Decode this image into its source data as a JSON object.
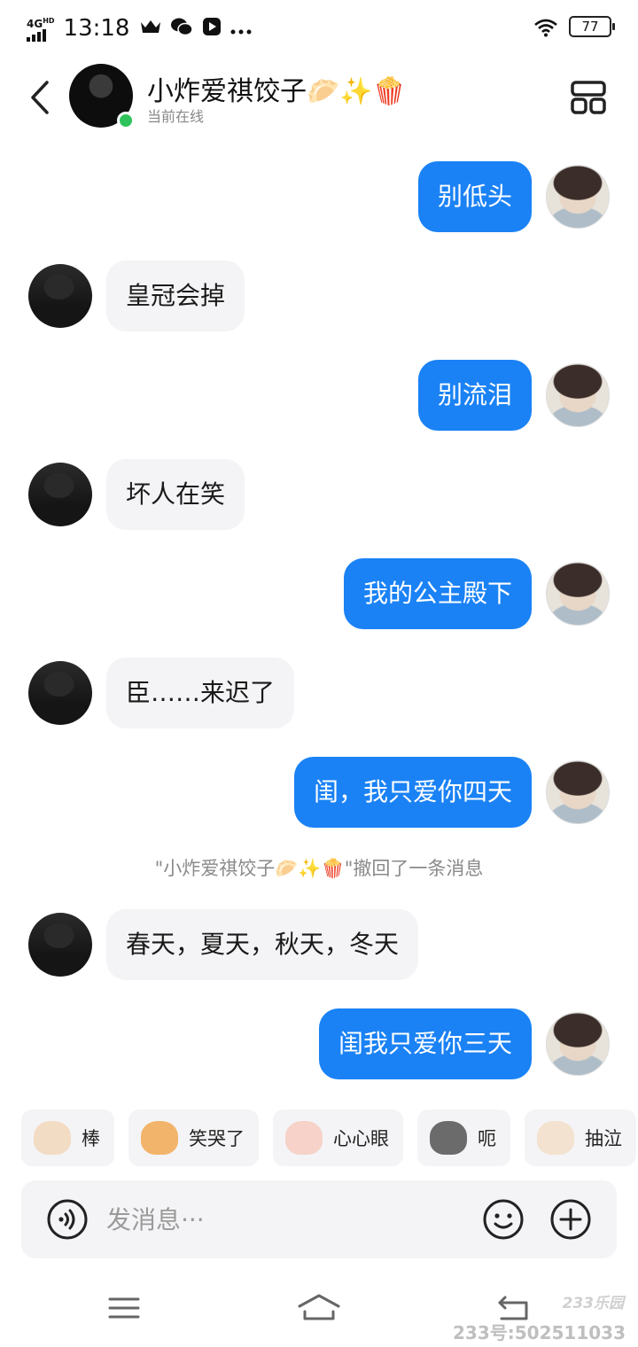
{
  "status_bar": {
    "network": "4G",
    "network_sup": "HD",
    "time": "13:18",
    "battery": "77"
  },
  "header": {
    "contact_name": "小炸爱祺饺子🥟✨🍿",
    "contact_status": "当前在线"
  },
  "messages": [
    {
      "side": "out",
      "text": "别低头"
    },
    {
      "side": "in",
      "text": "皇冠会掉"
    },
    {
      "side": "out",
      "text": "别流泪"
    },
    {
      "side": "in",
      "text": "坏人在笑"
    },
    {
      "side": "out",
      "text": "我的公主殿下"
    },
    {
      "side": "in",
      "text": "臣……来迟了"
    },
    {
      "side": "out",
      "text": "闺，我只爱你四天"
    },
    {
      "side": "in",
      "text": "春天，夏天，秋天，冬天"
    },
    {
      "side": "out",
      "text": "闺我只爱你三天"
    }
  ],
  "system_notice": "\"小炸爱祺饺子🥟✨🍿\"撤回了一条消息",
  "quick_reactions": [
    {
      "label": "棒",
      "icon": "cat-sticker-icon",
      "color": "#f3dcc4"
    },
    {
      "label": "笑哭了",
      "icon": "shiba-sticker-icon",
      "color": "#f2b46a"
    },
    {
      "label": "心心眼",
      "icon": "heart-eyes-sticker-icon",
      "color": "#f6d2c8"
    },
    {
      "label": "呃",
      "icon": "grey-cat-sticker-icon",
      "color": "#6b6b6b"
    },
    {
      "label": "抽泣",
      "icon": "crying-cat-sticker-icon",
      "color": "#f3e2cf"
    }
  ],
  "input": {
    "placeholder": "发消息···"
  },
  "watermark": {
    "logo": "233乐园",
    "id": "233号:502511033"
  },
  "colors": {
    "outgoing_bubble": "#1a82f5",
    "incoming_bubble": "#f4f4f6",
    "online": "#2fc45b"
  }
}
